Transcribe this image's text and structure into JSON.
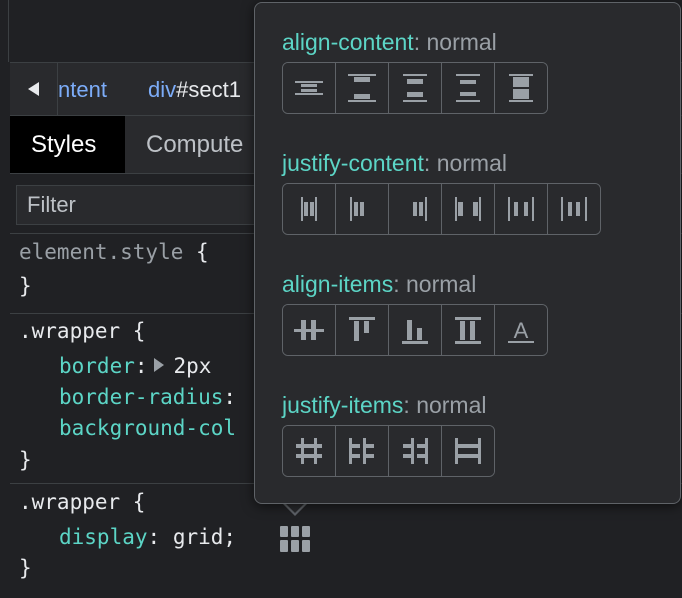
{
  "breadcrumb": {
    "item1": "ntent",
    "item2_tag": "div",
    "item2_id": "#sect1"
  },
  "tabs": [
    {
      "label": "Styles",
      "active": true
    },
    {
      "label": "Compute",
      "active": false
    }
  ],
  "filter": {
    "placeholder": "Filter"
  },
  "rules": {
    "element_style": {
      "selector": "element.style",
      "open": " {",
      "close": "}"
    },
    "wrapper1": {
      "selector": ".wrapper",
      "open": " {",
      "close": "}",
      "decls": [
        {
          "prop": "border",
          "value": "2px"
        },
        {
          "prop": "border-radius",
          "value": ""
        },
        {
          "prop": "background-col",
          "value": ""
        }
      ]
    },
    "wrapper2": {
      "selector": ".wrapper",
      "open": " {",
      "close": "}",
      "decls": [
        {
          "prop": "display",
          "value": "grid;"
        }
      ]
    }
  },
  "popup": {
    "sections": [
      {
        "name": "align-content",
        "value": "normal",
        "buttons": [
          "align-content-center-icon",
          "align-content-space-between-icon",
          "align-content-space-around-icon",
          "align-content-space-evenly-icon",
          "align-content-stretch-icon"
        ]
      },
      {
        "name": "justify-content",
        "value": "normal",
        "buttons": [
          "justify-content-center-icon",
          "justify-content-flex-start-icon",
          "justify-content-flex-end-icon",
          "justify-content-space-between-icon",
          "justify-content-space-around-icon",
          "justify-content-space-evenly-icon"
        ]
      },
      {
        "name": "align-items",
        "value": "normal",
        "buttons": [
          "align-items-center-icon",
          "align-items-flex-start-icon",
          "align-items-flex-end-icon",
          "align-items-stretch-icon",
          "align-items-baseline-icon"
        ]
      },
      {
        "name": "justify-items",
        "value": "normal",
        "buttons": [
          "justify-items-center-icon",
          "justify-items-start-icon",
          "justify-items-end-icon",
          "justify-items-stretch-icon"
        ]
      }
    ],
    "baseline_glyph": "A"
  },
  "colors": {
    "property": "#5cd5c6",
    "link": "#7cacf8",
    "icon": "#9aa0a6",
    "panel": "#292a2d",
    "border": "#5f6368"
  }
}
